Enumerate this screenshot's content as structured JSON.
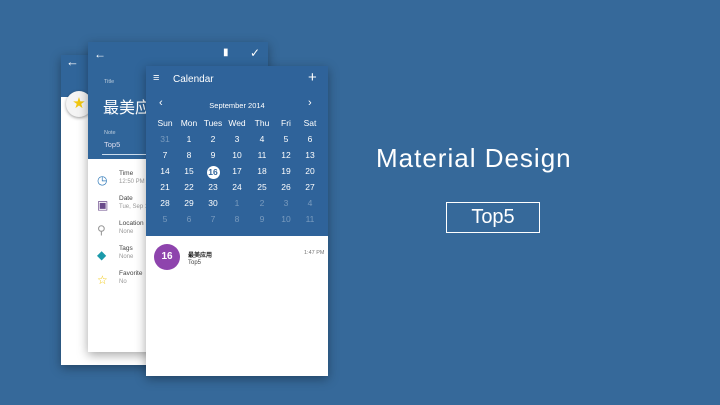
{
  "hero": {
    "title": "Material Design",
    "badge": "Top5"
  },
  "edit_screen": {
    "title_label": "Title",
    "title_value": "最美应",
    "note_label": "Note",
    "note_value": "Top5",
    "fields": [
      {
        "label": "Time",
        "value": "12:50 PM",
        "icon": "clock-icon"
      },
      {
        "label": "Date",
        "value": "Tue, Sep 1",
        "icon": "calendar-icon"
      },
      {
        "label": "Location",
        "value": "None",
        "icon": "location-pin-icon"
      },
      {
        "label": "Tags",
        "value": "None",
        "icon": "tag-icon"
      },
      {
        "label": "Favorite",
        "value": "No",
        "icon": "star-outline-icon"
      }
    ]
  },
  "calendar": {
    "title": "Calendar",
    "month": "September 2014",
    "weekdays": [
      "Sun",
      "Mon",
      "Tues",
      "Wed",
      "Thu",
      "Fri",
      "Sat"
    ],
    "weeks": [
      [
        "31",
        "1",
        "2",
        "3",
        "4",
        "5",
        "6"
      ],
      [
        "7",
        "8",
        "9",
        "10",
        "11",
        "12",
        "13"
      ],
      [
        "14",
        "15",
        "16",
        "17",
        "18",
        "19",
        "20"
      ],
      [
        "21",
        "22",
        "23",
        "24",
        "25",
        "26",
        "27"
      ],
      [
        "28",
        "29",
        "30",
        "1",
        "2",
        "3",
        "4"
      ],
      [
        "5",
        "6",
        "7",
        "8",
        "9",
        "10",
        "11"
      ]
    ],
    "selected": "16",
    "event": {
      "day": "16",
      "title": "最美应用",
      "subtitle": "Top5",
      "time": "1:47 PM",
      "color": "#8e44ad"
    }
  }
}
